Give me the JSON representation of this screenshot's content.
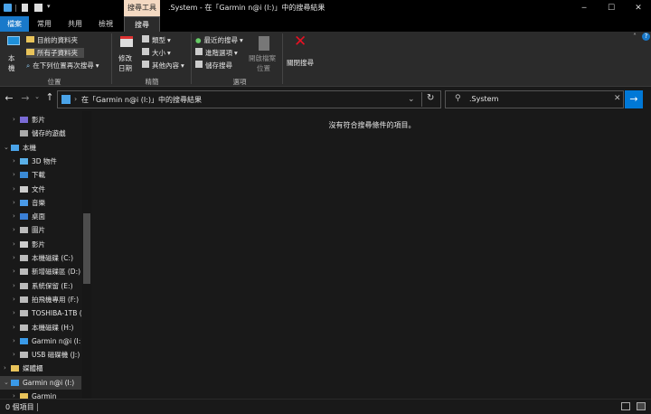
{
  "window": {
    "title": ".System - 在「Garmin n@i (I:)」中的搜尋結果",
    "contextual_group": "搜尋工具",
    "minimize": "─",
    "maximize": "☐",
    "close": "✕"
  },
  "ribbon_tabs": [
    "檔案",
    "常用",
    "共用",
    "檢視",
    "搜尋"
  ],
  "ribbon": {
    "location": {
      "this_pc_label_top": "本",
      "this_pc_label_bottom": "機",
      "current_folder": "目前的資料夾",
      "all_subfolders": "所有子資料夾",
      "search_again_in": "在下列位置再次搜尋",
      "group_label": "位置"
    },
    "refine": {
      "date_modified_top": "修改",
      "date_modified_bottom": "日期",
      "kind": "類型",
      "size": "大小",
      "other_properties": "其他內容",
      "group_label": "精簡"
    },
    "options": {
      "recent_searches": "最近的搜尋",
      "advanced_options": "進階選項",
      "save_search": "儲存搜尋",
      "open_file_location_top": "開啟檔案",
      "open_file_location_bottom": "位置",
      "group_label": "選項"
    },
    "close_search": "關閉搜尋"
  },
  "address": {
    "path": "在「Garmin n@i (I:)」中的搜尋結果",
    "search_value": ".System"
  },
  "tree": [
    {
      "label": "影片",
      "indent": 1,
      "chev": ">",
      "icon": "video-folder"
    },
    {
      "label": "儲存的遊戲",
      "indent": 1,
      "chev": "",
      "icon": "saved-games"
    },
    {
      "label": "本機",
      "indent": 0,
      "chev": "v",
      "icon": "computer"
    },
    {
      "label": "3D 物件",
      "indent": 1,
      "chev": ">",
      "icon": "3d-objects"
    },
    {
      "label": "下載",
      "indent": 1,
      "chev": ">",
      "icon": "downloads"
    },
    {
      "label": "文件",
      "indent": 1,
      "chev": ">",
      "icon": "documents"
    },
    {
      "label": "音樂",
      "indent": 1,
      "chev": ">",
      "icon": "music"
    },
    {
      "label": "桌面",
      "indent": 1,
      "chev": ">",
      "icon": "desktop"
    },
    {
      "label": "圖片",
      "indent": 1,
      "chev": ">",
      "icon": "pictures"
    },
    {
      "label": "影片",
      "indent": 1,
      "chev": ">",
      "icon": "videos"
    },
    {
      "label": "本機磁碟 (C:)",
      "indent": 1,
      "chev": ">",
      "icon": "drive"
    },
    {
      "label": "新增磁碟區 (D:)",
      "indent": 1,
      "chev": ">",
      "icon": "drive"
    },
    {
      "label": "系統保留 (E:)",
      "indent": 1,
      "chev": ">",
      "icon": "drive"
    },
    {
      "label": "拍飛機專用 (F:)",
      "indent": 1,
      "chev": ">",
      "icon": "drive"
    },
    {
      "label": "TOSHIBA-1TB (",
      "indent": 1,
      "chev": ">",
      "icon": "drive"
    },
    {
      "label": "本機磁碟 (H:)",
      "indent": 1,
      "chev": ">",
      "icon": "drive"
    },
    {
      "label": "Garmin n@i (I:)",
      "indent": 1,
      "chev": ">",
      "icon": "garmin-drive"
    },
    {
      "label": "USB 磁碟機 (J:)",
      "indent": 1,
      "chev": ">",
      "icon": "usb-drive"
    },
    {
      "label": "媒體櫃",
      "indent": 0,
      "chev": ">",
      "icon": "libraries"
    },
    {
      "label": "Garmin n@i (I:)",
      "indent": 0,
      "chev": "v",
      "icon": "garmin-drive",
      "selected": true
    },
    {
      "label": "Garmin",
      "indent": 1,
      "chev": ">",
      "icon": "folder"
    }
  ],
  "content": {
    "empty_message": "沒有符合搜尋條件的項目。"
  },
  "status": {
    "item_count": "0 個項目"
  },
  "colors": {
    "accent": "#0078d7",
    "contextual_tab": "#f3d9c2",
    "selected_row": "#3a3a3a"
  }
}
